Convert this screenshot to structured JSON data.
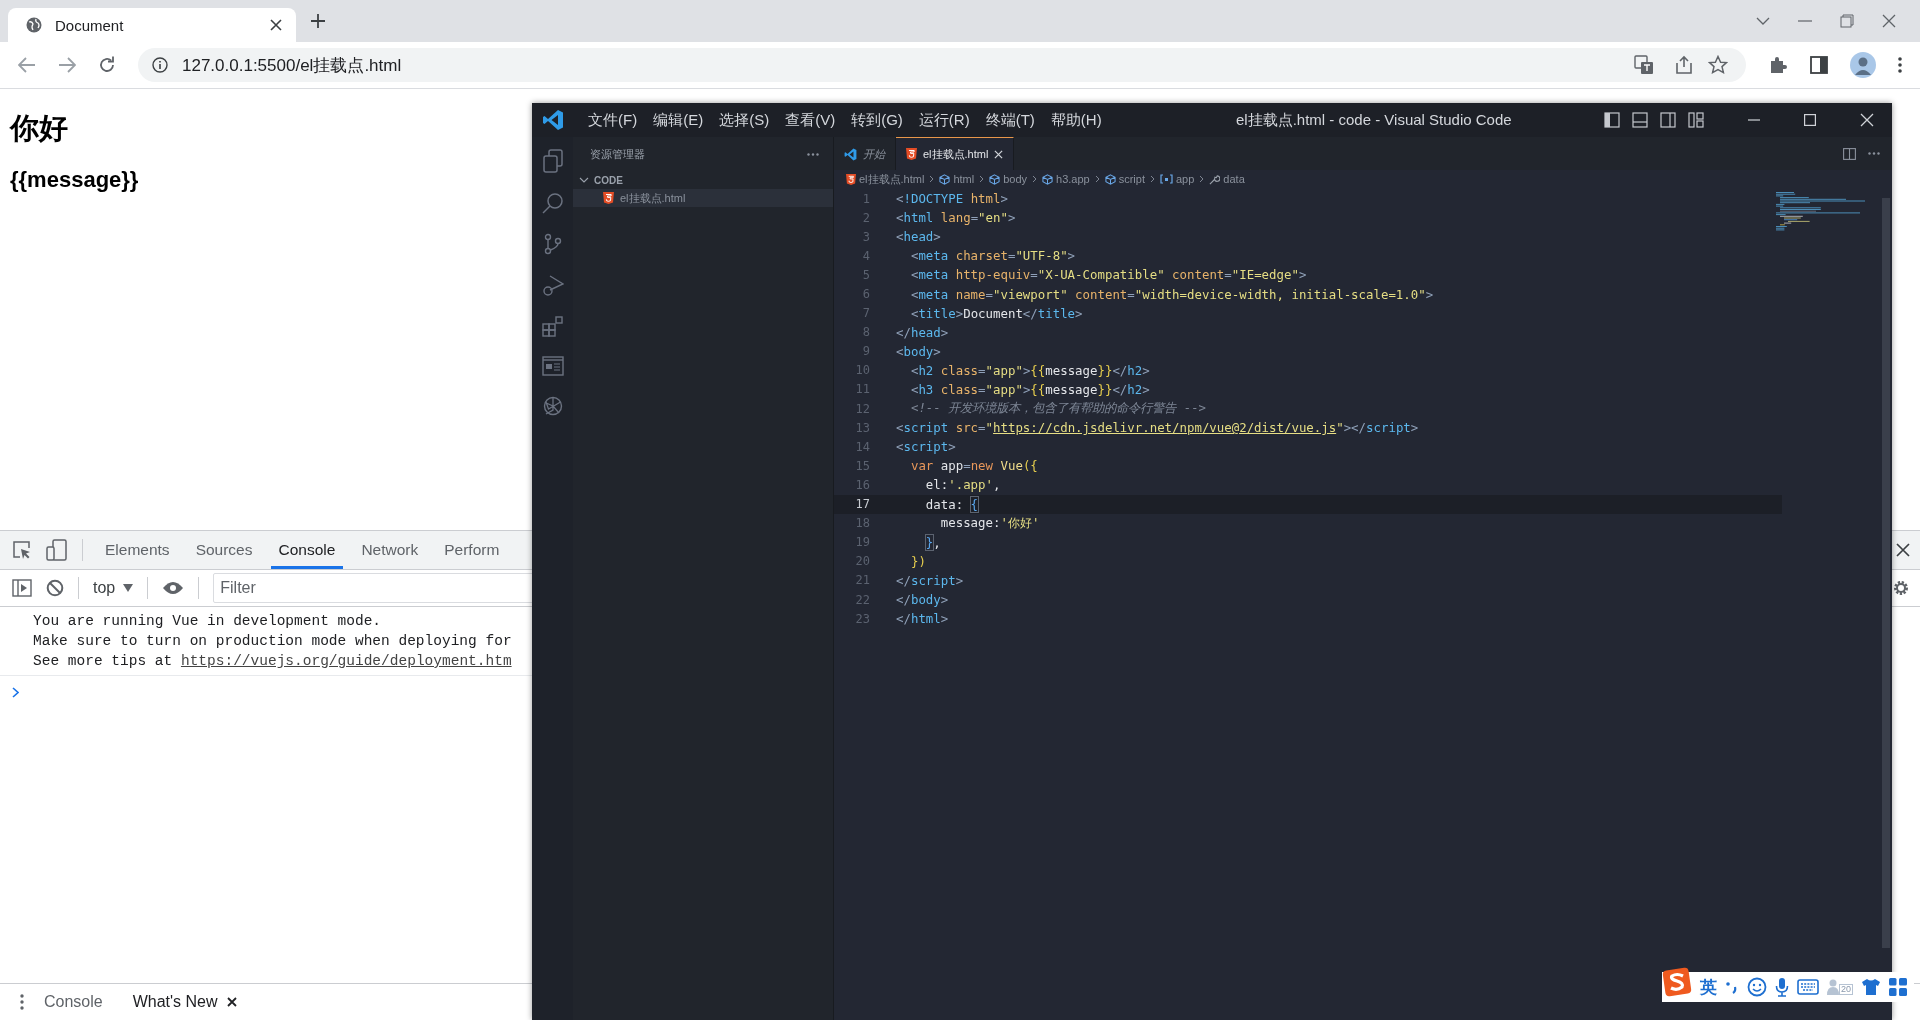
{
  "browser": {
    "tab": {
      "title": "Document"
    },
    "url": "127.0.0.1:5500/el挂载点.html"
  },
  "page": {
    "heading": "你好",
    "subheading": "{{message}}"
  },
  "devtools": {
    "tabs": [
      {
        "label": "Elements",
        "selected": false
      },
      {
        "label": "Sources",
        "selected": false
      },
      {
        "label": "Console",
        "selected": true
      },
      {
        "label": "Network",
        "selected": false
      },
      {
        "label": "Perform",
        "selected": false
      }
    ],
    "context": "top",
    "filter": {
      "placeholder": "Filter"
    },
    "console": {
      "lines": [
        "You are running Vue in development mode.",
        "Make sure to turn on production mode when deploying for"
      ],
      "tip": {
        "text": "See more tips at",
        "link": "https://vuejs.org/guide/deployment.htm"
      }
    },
    "drawer": [
      {
        "label": "Console",
        "selected": false
      },
      {
        "label": "What's New",
        "selected": true
      }
    ]
  },
  "vscode": {
    "title": "el挂载点.html - code - Visual Studio Code",
    "menu": [
      "文件(F)",
      "编辑(E)",
      "选择(S)",
      "查看(V)",
      "转到(G)",
      "运行(R)",
      "终端(T)",
      "帮助(H)"
    ],
    "explorer": {
      "title": "资源管理器",
      "folder": {
        "name": "CODE",
        "expanded": true,
        "children": [
          {
            "name": "el挂载点.html",
            "selected": true
          }
        ]
      }
    },
    "tabs": [
      {
        "label": "开始",
        "kind": "welcome",
        "selected": false
      },
      {
        "label": "el挂载点.html",
        "kind": "html",
        "selected": true
      }
    ],
    "breadcrumb": [
      {
        "label": "el挂载点.html",
        "kind": "file"
      },
      {
        "label": "html",
        "kind": "element"
      },
      {
        "label": "body",
        "kind": "element"
      },
      {
        "label": "h3.app",
        "kind": "element"
      },
      {
        "label": "script",
        "kind": "element"
      },
      {
        "label": "app",
        "kind": "variable"
      },
      {
        "label": "data",
        "kind": "property"
      }
    ],
    "code": [
      {
        "number": "1",
        "current": false,
        "tokens": [
          {
            "text": "<",
            "kind": "p"
          },
          {
            "text": "!DOCTYPE",
            "kind": "tag"
          },
          {
            "text": " html",
            "kind": "attr"
          },
          {
            "text": ">",
            "kind": "p"
          }
        ]
      },
      {
        "number": "2",
        "current": false,
        "tokens": [
          {
            "text": "<",
            "kind": "p"
          },
          {
            "text": "html",
            "kind": "tag"
          },
          {
            "text": " lang",
            "kind": "attr"
          },
          {
            "text": "=",
            "kind": "p"
          },
          {
            "text": "\"en\"",
            "kind": "str"
          },
          {
            "text": ">",
            "kind": "p"
          }
        ]
      },
      {
        "number": "3",
        "current": false,
        "tokens": [
          {
            "text": "<",
            "kind": "p"
          },
          {
            "text": "head",
            "kind": "tag"
          },
          {
            "text": ">",
            "kind": "p"
          }
        ]
      },
      {
        "number": "4",
        "current": false,
        "tokens": [
          {
            "text": "  <",
            "kind": "p"
          },
          {
            "text": "meta",
            "kind": "tag"
          },
          {
            "text": " charset",
            "kind": "attr"
          },
          {
            "text": "=",
            "kind": "p"
          },
          {
            "text": "\"UTF-8\"",
            "kind": "str"
          },
          {
            "text": ">",
            "kind": "p"
          }
        ]
      },
      {
        "number": "5",
        "current": false,
        "tokens": [
          {
            "text": "  <",
            "kind": "p"
          },
          {
            "text": "meta",
            "kind": "tag"
          },
          {
            "text": " http-equiv",
            "kind": "attr"
          },
          {
            "text": "=",
            "kind": "p"
          },
          {
            "text": "\"X-UA-Compatible\"",
            "kind": "str"
          },
          {
            "text": " content",
            "kind": "attr"
          },
          {
            "text": "=",
            "kind": "p"
          },
          {
            "text": "\"IE=edge\"",
            "kind": "str"
          },
          {
            "text": ">",
            "kind": "p"
          }
        ]
      },
      {
        "number": "6",
        "current": false,
        "tokens": [
          {
            "text": "  <",
            "kind": "p"
          },
          {
            "text": "meta",
            "kind": "tag"
          },
          {
            "text": " name",
            "kind": "attr"
          },
          {
            "text": "=",
            "kind": "p"
          },
          {
            "text": "\"viewport\"",
            "kind": "str"
          },
          {
            "text": " content",
            "kind": "attr"
          },
          {
            "text": "=",
            "kind": "p"
          },
          {
            "text": "\"width=device-width, initial-scale=1.0\"",
            "kind": "str"
          },
          {
            "text": ">",
            "kind": "p"
          }
        ]
      },
      {
        "number": "7",
        "current": false,
        "tokens": [
          {
            "text": "  <",
            "kind": "p"
          },
          {
            "text": "title",
            "kind": "tag"
          },
          {
            "text": ">",
            "kind": "p"
          },
          {
            "text": "Document",
            "kind": "txt"
          },
          {
            "text": "</",
            "kind": "p"
          },
          {
            "text": "title",
            "kind": "tag"
          },
          {
            "text": ">",
            "kind": "p"
          }
        ]
      },
      {
        "number": "8",
        "current": false,
        "tokens": [
          {
            "text": "</",
            "kind": "p"
          },
          {
            "text": "head",
            "kind": "tag"
          },
          {
            "text": ">",
            "kind": "p"
          }
        ]
      },
      {
        "number": "9",
        "current": false,
        "tokens": [
          {
            "text": "<",
            "kind": "p"
          },
          {
            "text": "body",
            "kind": "tag"
          },
          {
            "text": ">",
            "kind": "p"
          }
        ]
      },
      {
        "number": "10",
        "current": false,
        "tokens": [
          {
            "text": "  <",
            "kind": "p"
          },
          {
            "text": "h2",
            "kind": "tag"
          },
          {
            "text": " class",
            "kind": "attr"
          },
          {
            "text": "=",
            "kind": "p"
          },
          {
            "text": "\"app\"",
            "kind": "str"
          },
          {
            "text": ">",
            "kind": "p"
          },
          {
            "text": "{{",
            "kind": "br"
          },
          {
            "text": "message",
            "kind": "txt"
          },
          {
            "text": "}}",
            "kind": "br"
          },
          {
            "text": "</",
            "kind": "p"
          },
          {
            "text": "h2",
            "kind": "tag"
          },
          {
            "text": ">",
            "kind": "p"
          }
        ]
      },
      {
        "number": "11",
        "current": false,
        "tokens": [
          {
            "text": "  <",
            "kind": "p"
          },
          {
            "text": "h3",
            "kind": "tag"
          },
          {
            "text": " class",
            "kind": "attr"
          },
          {
            "text": "=",
            "kind": "p"
          },
          {
            "text": "\"app\"",
            "kind": "str"
          },
          {
            "text": ">",
            "kind": "p"
          },
          {
            "text": "{{",
            "kind": "br"
          },
          {
            "text": "message",
            "kind": "txt"
          },
          {
            "text": "}}",
            "kind": "br"
          },
          {
            "text": "</",
            "kind": "p"
          },
          {
            "text": "h2",
            "kind": "tag"
          },
          {
            "text": ">",
            "kind": "p"
          }
        ]
      },
      {
        "number": "12",
        "current": false,
        "tokens": [
          {
            "text": "  <!-- 开发环境版本，包含了有帮助的命令行警告 -->",
            "kind": "cm"
          }
        ]
      },
      {
        "number": "13",
        "current": false,
        "tokens": [
          {
            "text": "<",
            "kind": "p"
          },
          {
            "text": "script",
            "kind": "tag"
          },
          {
            "text": " src",
            "kind": "attr"
          },
          {
            "text": "=",
            "kind": "p"
          },
          {
            "text": "\"",
            "kind": "str"
          },
          {
            "text": "https://cdn.jsdelivr.net/npm/vue@2/dist/vue.js",
            "kind": "link"
          },
          {
            "text": "\"",
            "kind": "str"
          },
          {
            "text": "></",
            "kind": "p"
          },
          {
            "text": "script",
            "kind": "tag"
          },
          {
            "text": ">",
            "kind": "p"
          }
        ]
      },
      {
        "number": "14",
        "current": false,
        "tokens": [
          {
            "text": "<",
            "kind": "p"
          },
          {
            "text": "script",
            "kind": "tag"
          },
          {
            "text": ">",
            "kind": "p"
          }
        ]
      },
      {
        "number": "15",
        "current": false,
        "tokens": [
          {
            "text": "  var",
            "kind": "kw"
          },
          {
            "text": " app",
            "kind": "txt"
          },
          {
            "text": "=",
            "kind": "p"
          },
          {
            "text": "new",
            "kind": "kw"
          },
          {
            "text": " Vue",
            "kind": "fn"
          },
          {
            "text": "({",
            "kind": "br"
          }
        ]
      },
      {
        "number": "16",
        "current": false,
        "tokens": [
          {
            "text": "    el:",
            "kind": "txt"
          },
          {
            "text": "'.app'",
            "kind": "str"
          },
          {
            "text": ",",
            "kind": "txt"
          }
        ]
      },
      {
        "number": "17",
        "current": true,
        "tokens": [
          {
            "text": "    data: ",
            "kind": "txt"
          },
          {
            "text": "{",
            "kind": "match"
          }
        ]
      },
      {
        "number": "18",
        "current": false,
        "tokens": [
          {
            "text": "      message:",
            "kind": "txt"
          },
          {
            "text": "'你好'",
            "kind": "str"
          }
        ]
      },
      {
        "number": "19",
        "current": false,
        "tokens": [
          {
            "text": "    }",
            "kind": "match"
          },
          {
            "text": ",",
            "kind": "txt"
          }
        ]
      },
      {
        "number": "20",
        "current": false,
        "tokens": [
          {
            "text": "  })",
            "kind": "br"
          }
        ]
      },
      {
        "number": "21",
        "current": false,
        "tokens": [
          {
            "text": "</",
            "kind": "p"
          },
          {
            "text": "script",
            "kind": "tag"
          },
          {
            "text": ">",
            "kind": "p"
          }
        ]
      },
      {
        "number": "22",
        "current": false,
        "tokens": [
          {
            "text": "</",
            "kind": "p"
          },
          {
            "text": "body",
            "kind": "tag"
          },
          {
            "text": ">",
            "kind": "p"
          }
        ]
      },
      {
        "number": "23",
        "current": false,
        "tokens": [
          {
            "text": "</",
            "kind": "p"
          },
          {
            "text": "html",
            "kind": "tag"
          },
          {
            "text": ">",
            "kind": "p"
          }
        ]
      }
    ]
  },
  "ime": {
    "mode": "英",
    "badge": "20"
  }
}
